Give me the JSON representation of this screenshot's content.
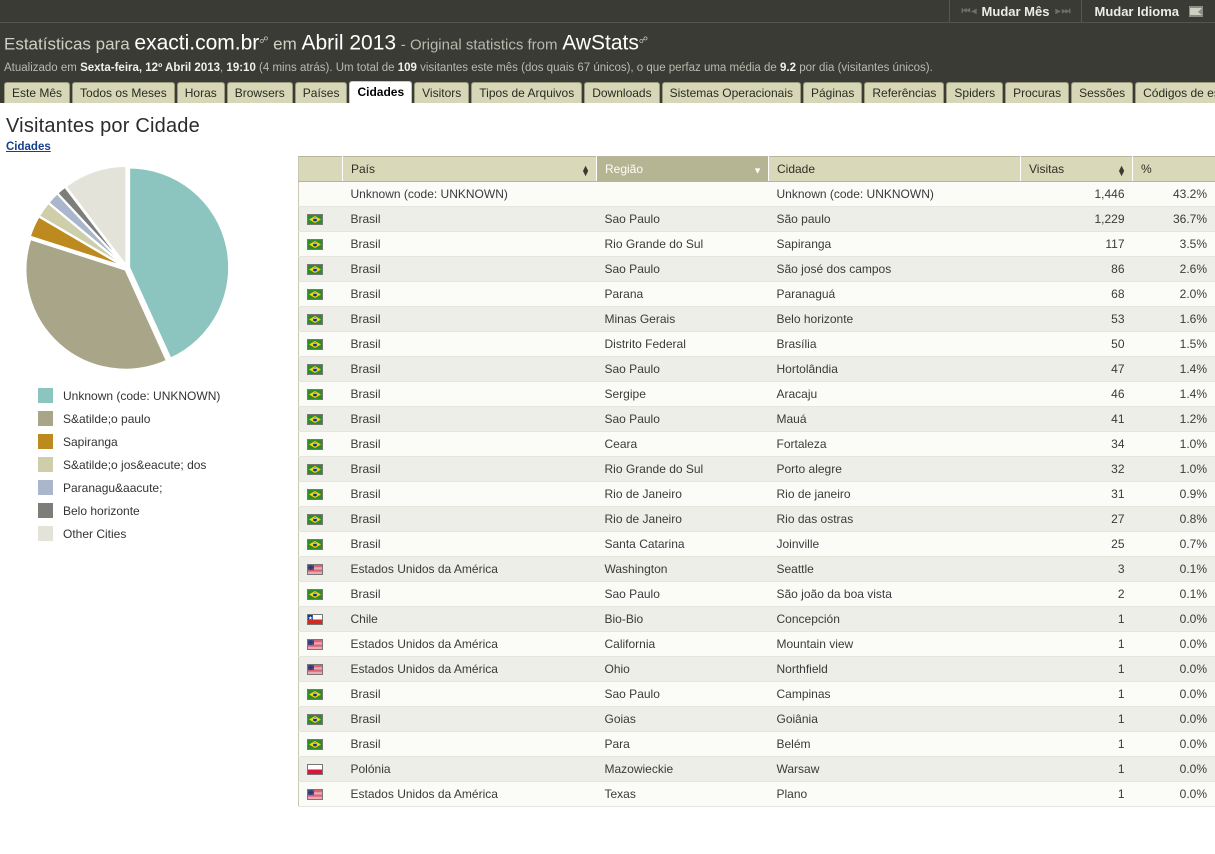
{
  "topnav": {
    "month_label": "Mudar Mês",
    "language_label": "Mudar Idioma",
    "first_icon": "first-page-icon",
    "prev_icon": "prev-page-icon",
    "next_icon": "next-page-icon",
    "last_icon": "last-page-icon"
  },
  "header": {
    "line1_prefix": "Estatísticas para",
    "site": "exacti.com.br",
    "line1_mid": "em",
    "period": "Abril 2013",
    "line1_sep": "- Original statistics from",
    "source": "AwStats",
    "updated_prefix": "Atualizado em",
    "updated_date": "Sexta-feira, 12º Abril 2013",
    "updated_comma": ",",
    "updated_time": "19:10",
    "updated_ago": "(4 mins atrás). Um total de",
    "visitors_total": "109",
    "visitors_text": "visitantes este mês (dos quais 67 únicos), o que perfaz uma média de",
    "avg_per_day": "9.2",
    "avg_suffix": "por dia (visitantes únicos)."
  },
  "tabs": [
    {
      "label": "Este Mês",
      "active": false
    },
    {
      "label": "Todos os Meses",
      "active": false
    },
    {
      "label": "Horas",
      "active": false
    },
    {
      "label": "Browsers",
      "active": false
    },
    {
      "label": "Países",
      "active": false
    },
    {
      "label": "Cidades",
      "active": true
    },
    {
      "label": "Visitors",
      "active": false
    },
    {
      "label": "Tipos de Arquivos",
      "active": false
    },
    {
      "label": "Downloads",
      "active": false
    },
    {
      "label": "Sistemas Operacionais",
      "active": false
    },
    {
      "label": "Páginas",
      "active": false
    },
    {
      "label": "Referências",
      "active": false
    },
    {
      "label": "Spiders",
      "active": false
    },
    {
      "label": "Procuras",
      "active": false
    },
    {
      "label": "Sessões",
      "active": false
    },
    {
      "label": "Códigos de estado",
      "active": false
    }
  ],
  "main": {
    "title": "Visitantes por Cidade",
    "breadcrumb": "Cidades"
  },
  "chart_data": {
    "type": "pie",
    "title": "Visitantes por Cidade",
    "legend_position": "bottom-left",
    "labels": [
      "Unknown (code: UNKNOWN)",
      "S&atilde;o paulo",
      "Sapiranga",
      "S&atilde;o jos&eacute; dos",
      "Paranagu&aacute;",
      "Belo horizonte",
      "Other Cities"
    ],
    "values": [
      1446,
      1229,
      117,
      86,
      68,
      53,
      347
    ],
    "percents": [
      43.2,
      36.7,
      3.5,
      2.6,
      2.0,
      1.6,
      10.4
    ],
    "colors": [
      "#8cc5bf",
      "#a8a588",
      "#bc8a1e",
      "#cfceab",
      "#a9b6cb",
      "#7d7d79",
      "#e3e3da"
    ]
  },
  "table": {
    "columns": [
      {
        "key": "flag",
        "label": "",
        "sortable": false,
        "sorted": false,
        "align": "left"
      },
      {
        "key": "country",
        "label": "País",
        "sortable": true,
        "sorted": false,
        "align": "left"
      },
      {
        "key": "region",
        "label": "Região",
        "sortable": true,
        "sorted": true,
        "align": "left"
      },
      {
        "key": "city",
        "label": "Cidade",
        "sortable": false,
        "sorted": false,
        "align": "left"
      },
      {
        "key": "visits",
        "label": "Visitas",
        "sortable": true,
        "sorted": false,
        "align": "left"
      },
      {
        "key": "pct",
        "label": "%",
        "sortable": false,
        "sorted": false,
        "align": "left"
      }
    ],
    "rows": [
      {
        "flag": "none",
        "country": "Unknown (code: UNKNOWN)",
        "region": "",
        "city": "Unknown (code: UNKNOWN)",
        "visits": "1,446",
        "pct": "43.2%"
      },
      {
        "flag": "br",
        "country": "Brasil",
        "region": "Sao Paulo",
        "city": "São paulo",
        "visits": "1,229",
        "pct": "36.7%"
      },
      {
        "flag": "br",
        "country": "Brasil",
        "region": "Rio Grande do Sul",
        "city": "Sapiranga",
        "visits": "117",
        "pct": "3.5%"
      },
      {
        "flag": "br",
        "country": "Brasil",
        "region": "Sao Paulo",
        "city": "São josé dos campos",
        "visits": "86",
        "pct": "2.6%"
      },
      {
        "flag": "br",
        "country": "Brasil",
        "region": "Parana",
        "city": "Paranaguá",
        "visits": "68",
        "pct": "2.0%"
      },
      {
        "flag": "br",
        "country": "Brasil",
        "region": "Minas Gerais",
        "city": "Belo horizonte",
        "visits": "53",
        "pct": "1.6%"
      },
      {
        "flag": "br",
        "country": "Brasil",
        "region": "Distrito Federal",
        "city": "Brasília",
        "visits": "50",
        "pct": "1.5%"
      },
      {
        "flag": "br",
        "country": "Brasil",
        "region": "Sao Paulo",
        "city": "Hortolândia",
        "visits": "47",
        "pct": "1.4%"
      },
      {
        "flag": "br",
        "country": "Brasil",
        "region": "Sergipe",
        "city": "Aracaju",
        "visits": "46",
        "pct": "1.4%"
      },
      {
        "flag": "br",
        "country": "Brasil",
        "region": "Sao Paulo",
        "city": "Mauá",
        "visits": "41",
        "pct": "1.2%"
      },
      {
        "flag": "br",
        "country": "Brasil",
        "region": "Ceara",
        "city": "Fortaleza",
        "visits": "34",
        "pct": "1.0%"
      },
      {
        "flag": "br",
        "country": "Brasil",
        "region": "Rio Grande do Sul",
        "city": "Porto alegre",
        "visits": "32",
        "pct": "1.0%"
      },
      {
        "flag": "br",
        "country": "Brasil",
        "region": "Rio de Janeiro",
        "city": "Rio de janeiro",
        "visits": "31",
        "pct": "0.9%"
      },
      {
        "flag": "br",
        "country": "Brasil",
        "region": "Rio de Janeiro",
        "city": "Rio das ostras",
        "visits": "27",
        "pct": "0.8%"
      },
      {
        "flag": "br",
        "country": "Brasil",
        "region": "Santa Catarina",
        "city": "Joinville",
        "visits": "25",
        "pct": "0.7%"
      },
      {
        "flag": "us",
        "country": "Estados Unidos da América",
        "region": "Washington",
        "city": "Seattle",
        "visits": "3",
        "pct": "0.1%"
      },
      {
        "flag": "br",
        "country": "Brasil",
        "region": "Sao Paulo",
        "city": "São joão da boa vista",
        "visits": "2",
        "pct": "0.1%"
      },
      {
        "flag": "cl",
        "country": "Chile",
        "region": "Bio-Bio",
        "city": "Concepción",
        "visits": "1",
        "pct": "0.0%"
      },
      {
        "flag": "us",
        "country": "Estados Unidos da América",
        "region": "California",
        "city": "Mountain view",
        "visits": "1",
        "pct": "0.0%"
      },
      {
        "flag": "us",
        "country": "Estados Unidos da América",
        "region": "Ohio",
        "city": "Northfield",
        "visits": "1",
        "pct": "0.0%"
      },
      {
        "flag": "br",
        "country": "Brasil",
        "region": "Sao Paulo",
        "city": "Campinas",
        "visits": "1",
        "pct": "0.0%"
      },
      {
        "flag": "br",
        "country": "Brasil",
        "region": "Goias",
        "city": "Goiânia",
        "visits": "1",
        "pct": "0.0%"
      },
      {
        "flag": "br",
        "country": "Brasil",
        "region": "Para",
        "city": "Belém",
        "visits": "1",
        "pct": "0.0%"
      },
      {
        "flag": "pl",
        "country": "Polónia",
        "region": "Mazowieckie",
        "city": "Warsaw",
        "visits": "1",
        "pct": "0.0%"
      },
      {
        "flag": "us",
        "country": "Estados Unidos da América",
        "region": "Texas",
        "city": "Plano",
        "visits": "1",
        "pct": "0.0%"
      }
    ]
  },
  "colors": {
    "header_bg": "#3b3b36",
    "tab_bg": "#d7d7b8",
    "th_bg": "#d9d9b9",
    "th_sorted_bg": "#b5b594",
    "row_odd": "#fbfbf8",
    "row_even": "#eeeee8",
    "link": "#16408c"
  }
}
